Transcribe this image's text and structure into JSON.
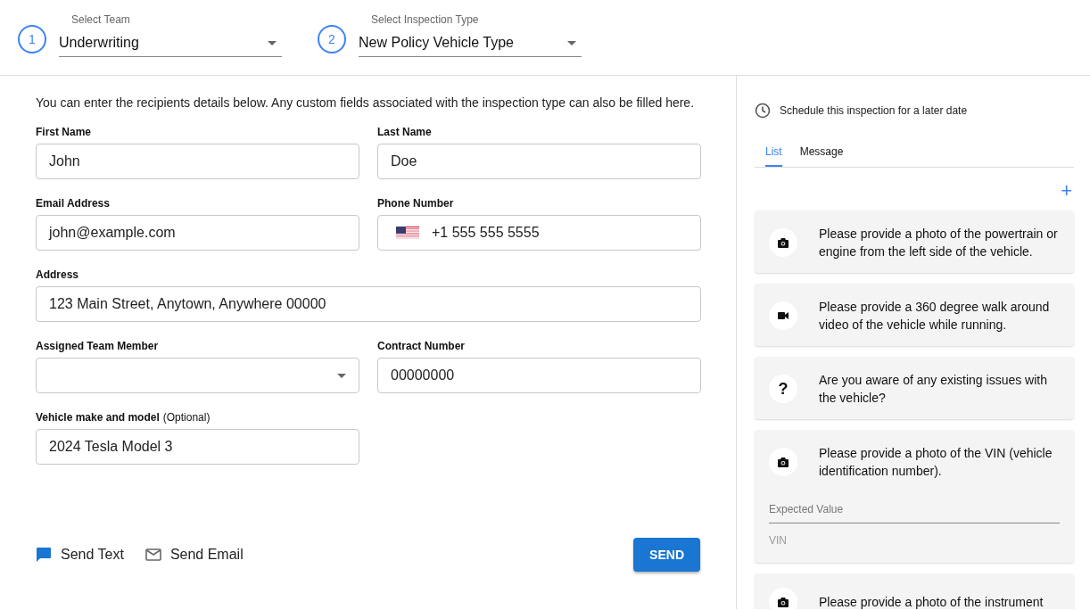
{
  "header": {
    "steps": [
      {
        "number": "1",
        "label": "Select Team",
        "value": "Underwriting"
      },
      {
        "number": "2",
        "label": "Select Inspection Type",
        "value": "New Policy Vehicle Type"
      }
    ]
  },
  "form": {
    "intro": "You can enter the recipients details below. Any custom fields associated with the inspection type can also be filled here.",
    "fields": [
      {
        "kind": "text",
        "label": "First Name",
        "value": "John",
        "full_width": false
      },
      {
        "kind": "text",
        "label": "Last Name",
        "value": "Doe",
        "full_width": false
      },
      {
        "kind": "text",
        "label": "Email Address",
        "value": "john@example.com",
        "full_width": false
      },
      {
        "kind": "phone",
        "label": "Phone Number",
        "value": "+1 555 555 5555",
        "full_width": false
      },
      {
        "kind": "text",
        "label": "Address",
        "value": "123 Main Street, Anytown, Anywhere 00000",
        "full_width": true
      },
      {
        "kind": "select",
        "label": "Assigned Team Member",
        "full_width": false
      },
      {
        "kind": "text",
        "label": "Contract Number",
        "value": "00000000",
        "full_width": false
      },
      {
        "kind": "text",
        "label": "Vehicle make and model",
        "note": "(Optional)",
        "value": "2024 Tesla Model 3",
        "full_width": false
      }
    ],
    "send_options": [
      {
        "kind": "text",
        "label": "Send Text",
        "selected": true
      },
      {
        "kind": "email",
        "label": "Send Email",
        "selected": false
      }
    ],
    "send_button": "SEND"
  },
  "side_panel": {
    "schedule_link": "Schedule this inspection for a later date",
    "tabs": [
      {
        "label": "List",
        "selected": true
      },
      {
        "label": "Message",
        "selected": false
      }
    ],
    "add_button": "+",
    "items": [
      {
        "kind": "photo",
        "text": "Please provide a photo of the powertrain or engine from the left side of the vehicle."
      },
      {
        "kind": "video",
        "text": "Please provide a 360 degree walk around video of the vehicle while running."
      },
      {
        "kind": "question",
        "text": "Are you aware of any existing issues with the vehicle?",
        "icon_text": "?"
      },
      {
        "kind": "photo",
        "text": "Please provide a photo of the VIN (vehicle identification number).",
        "expected_value": {
          "label": "Expected Value",
          "placeholder": "VIN"
        }
      },
      {
        "kind": "photo",
        "text": "Please provide a photo of the instrument"
      }
    ]
  }
}
